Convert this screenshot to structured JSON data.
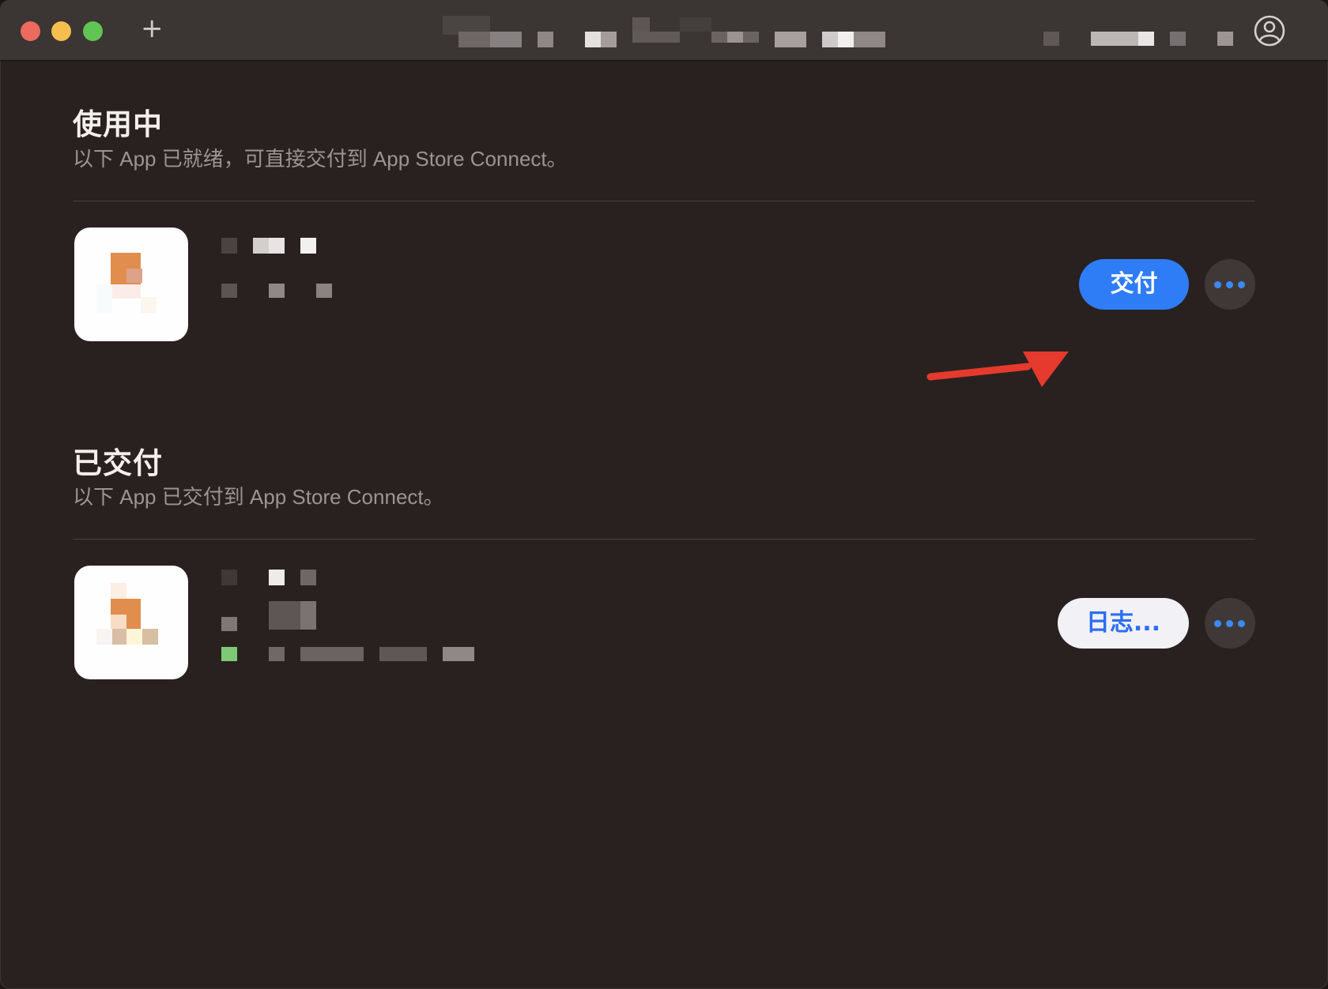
{
  "titlebar": {
    "add_tab_glyph": "+",
    "account_icon": "person-circle-icon"
  },
  "sections": [
    {
      "title": "使用中",
      "subtitle": "以下 App 已就绪，可直接交付到 App Store Connect。",
      "primary_button_label": "交付",
      "more_button_icon": "ellipsis-icon"
    },
    {
      "title": "已交付",
      "subtitle": "以下 App 已交付到 App Store Connect。",
      "primary_button_label": "日志...",
      "more_button_icon": "ellipsis-icon"
    }
  ],
  "colors": {
    "accent": "#2f7df6",
    "annotation_arrow": "#e53a2d",
    "background": "#292120"
  }
}
